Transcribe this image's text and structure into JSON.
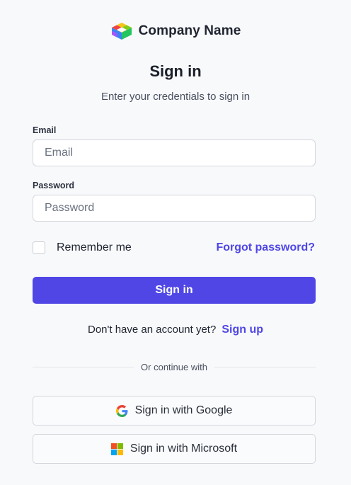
{
  "brand": {
    "name": "Company Name",
    "logo_icon": "cube-logo-icon"
  },
  "heading": {
    "title": "Sign in",
    "subtitle": "Enter your credentials to sign in"
  },
  "form": {
    "email": {
      "label": "Email",
      "placeholder": "Email",
      "value": ""
    },
    "password": {
      "label": "Password",
      "placeholder": "Password",
      "value": ""
    },
    "remember_label": "Remember me",
    "remember_checked": false,
    "forgot_label": "Forgot password?",
    "submit_label": "Sign in"
  },
  "signup": {
    "prompt": "Don't have an account yet?",
    "link_label": "Sign up"
  },
  "divider": {
    "label": "Or continue with"
  },
  "social": {
    "google": {
      "label": "Sign in with Google",
      "icon": "google-icon"
    },
    "microsoft": {
      "label": "Sign in with Microsoft",
      "icon": "microsoft-icon"
    }
  },
  "colors": {
    "accent": "#4f46e5",
    "background": "#f8f9fb",
    "border": "#d4d7dd"
  }
}
